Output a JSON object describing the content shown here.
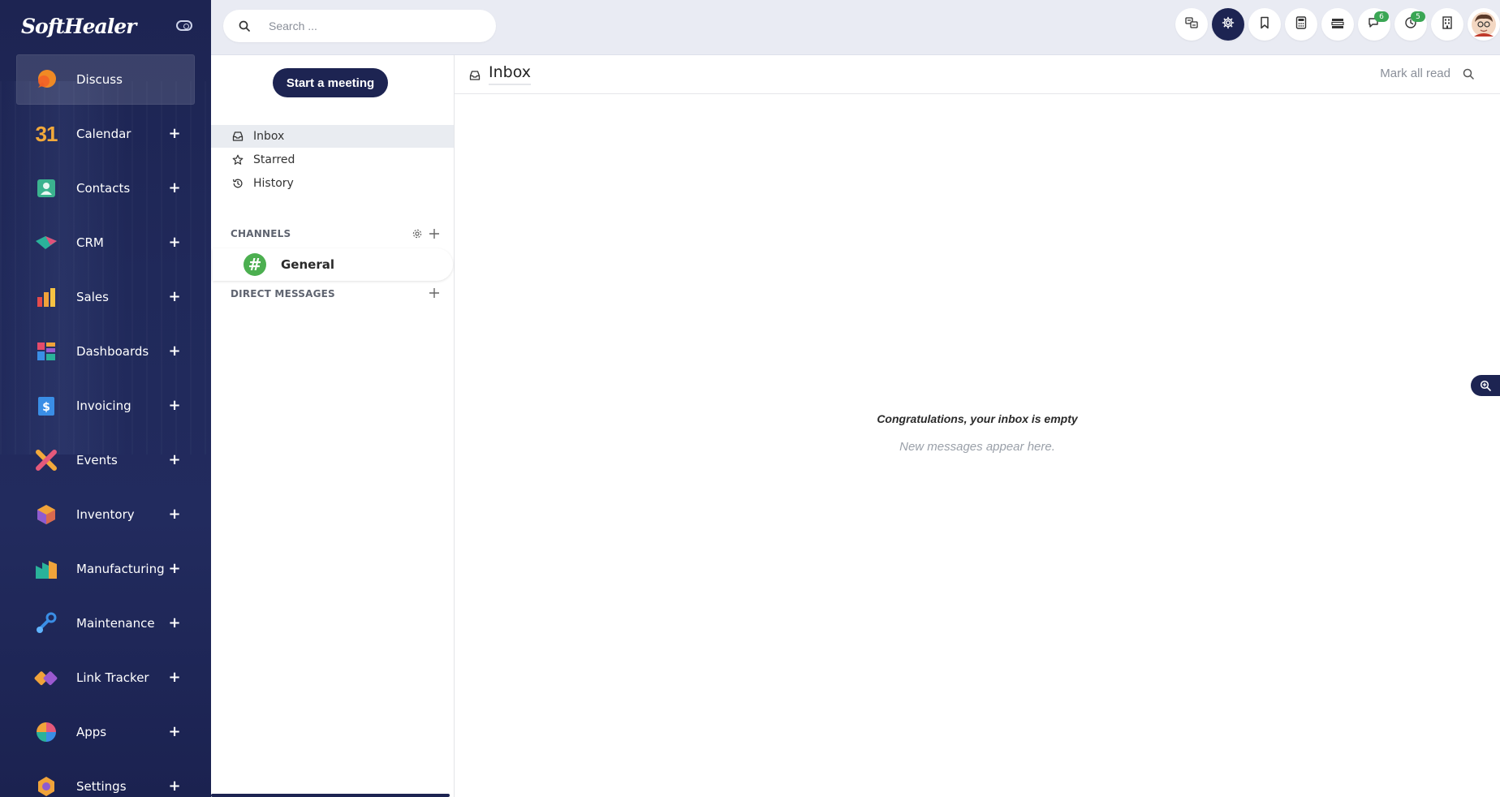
{
  "brand": {
    "name": "SoftHealer"
  },
  "sidebar": {
    "items": [
      {
        "label": "Discuss",
        "icon": "discuss-icon",
        "active": true,
        "plus": false
      },
      {
        "label": "Calendar",
        "icon": "calendar-icon",
        "plus": true
      },
      {
        "label": "Contacts",
        "icon": "contacts-icon",
        "plus": true
      },
      {
        "label": "CRM",
        "icon": "crm-icon",
        "plus": true
      },
      {
        "label": "Sales",
        "icon": "sales-icon",
        "plus": true
      },
      {
        "label": "Dashboards",
        "icon": "dashboards-icon",
        "plus": true
      },
      {
        "label": "Invoicing",
        "icon": "invoicing-icon",
        "plus": true
      },
      {
        "label": "Events",
        "icon": "events-icon",
        "plus": true
      },
      {
        "label": "Inventory",
        "icon": "inventory-icon",
        "plus": true
      },
      {
        "label": "Manufacturing",
        "icon": "manufacturing-icon",
        "plus": true
      },
      {
        "label": "Maintenance",
        "icon": "maintenance-icon",
        "plus": true
      },
      {
        "label": "Link Tracker",
        "icon": "link-tracker-icon",
        "plus": true
      },
      {
        "label": "Apps",
        "icon": "apps-icon",
        "plus": true
      },
      {
        "label": "Settings",
        "icon": "settings-icon",
        "plus": true
      }
    ],
    "calendar_day": "31",
    "plus_symbol": "+"
  },
  "topbar": {
    "search_placeholder": "Search ...",
    "icons": [
      {
        "name": "language-icon"
      },
      {
        "name": "gear-icon",
        "dark": true
      },
      {
        "name": "bookmark-icon"
      },
      {
        "name": "calculator-icon"
      },
      {
        "name": "list-icon"
      },
      {
        "name": "chat-icon",
        "badge": "6"
      },
      {
        "name": "clock-icon",
        "badge": "5"
      },
      {
        "name": "building-icon"
      }
    ]
  },
  "discuss": {
    "start_meeting": "Start a meeting",
    "nav": [
      {
        "label": "Inbox",
        "icon": "inbox-icon",
        "active": true
      },
      {
        "label": "Starred",
        "icon": "star-icon"
      },
      {
        "label": "History",
        "icon": "history-icon"
      }
    ],
    "channels_title": "CHANNELS",
    "channels": [
      {
        "label": "General",
        "symbol": "#"
      }
    ],
    "dm_title": "DIRECT MESSAGES"
  },
  "main": {
    "title": "Inbox",
    "mark_all_read": "Mark all read",
    "empty_title": "Congratulations, your inbox is empty",
    "empty_subtitle": "New messages appear here."
  },
  "colors": {
    "primary": "#1d2452",
    "badge": "#3aa654",
    "channel": "#4caf50"
  }
}
